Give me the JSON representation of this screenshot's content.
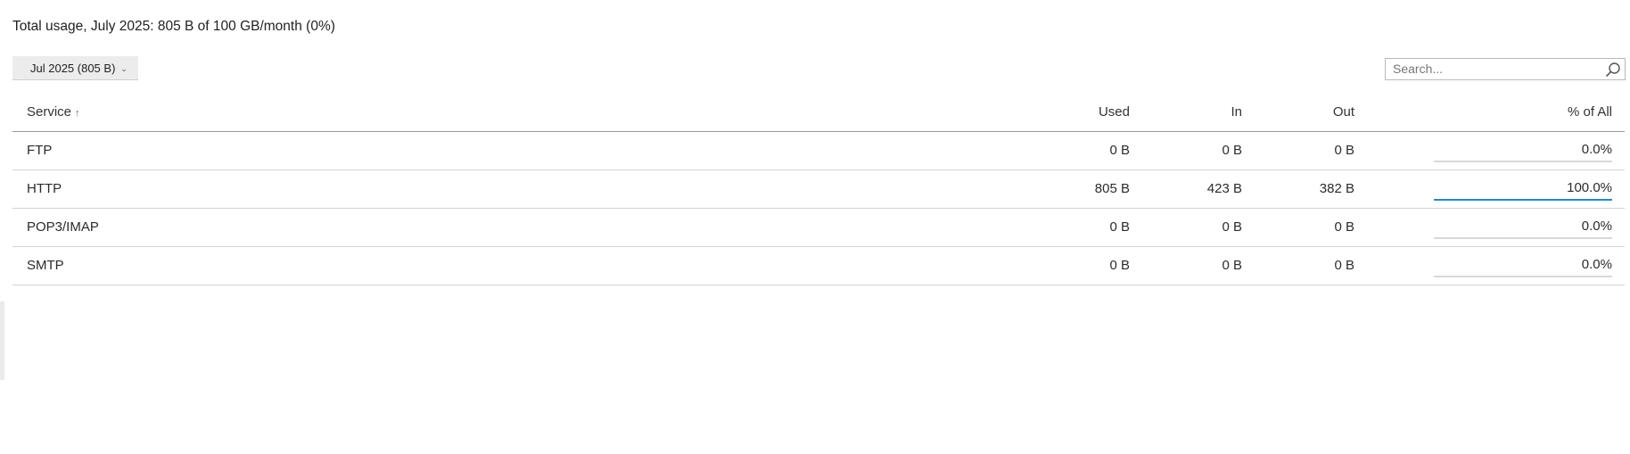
{
  "summary": "Total usage, July 2025: 805 B of 100 GB/month (0%)",
  "period_button": {
    "label": "Jul 2025 (805 B)",
    "chevron_icon": "chevron-down-icon"
  },
  "search": {
    "placeholder": "Search...",
    "value": "",
    "icon": "search-icon"
  },
  "table": {
    "headers": {
      "service": "Service",
      "sort_indicator": "↑",
      "used": "Used",
      "in": "In",
      "out": "Out",
      "pct": "% of All"
    },
    "rows": [
      {
        "service": "FTP",
        "used": "0 B",
        "in": "0 B",
        "out": "0 B",
        "pct": "0.0%",
        "pct_value": 0
      },
      {
        "service": "HTTP",
        "used": "805 B",
        "in": "423 B",
        "out": "382 B",
        "pct": "100.0%",
        "pct_value": 100
      },
      {
        "service": "POP3/IMAP",
        "used": "0 B",
        "in": "0 B",
        "out": "0 B",
        "pct": "0.0%",
        "pct_value": 0
      },
      {
        "service": "SMTP",
        "used": "0 B",
        "in": "0 B",
        "out": "0 B",
        "pct": "0.0%",
        "pct_value": 0
      }
    ]
  },
  "colors": {
    "progress_fill": "#1a8cd8",
    "progress_track": "#d8d8d8"
  }
}
